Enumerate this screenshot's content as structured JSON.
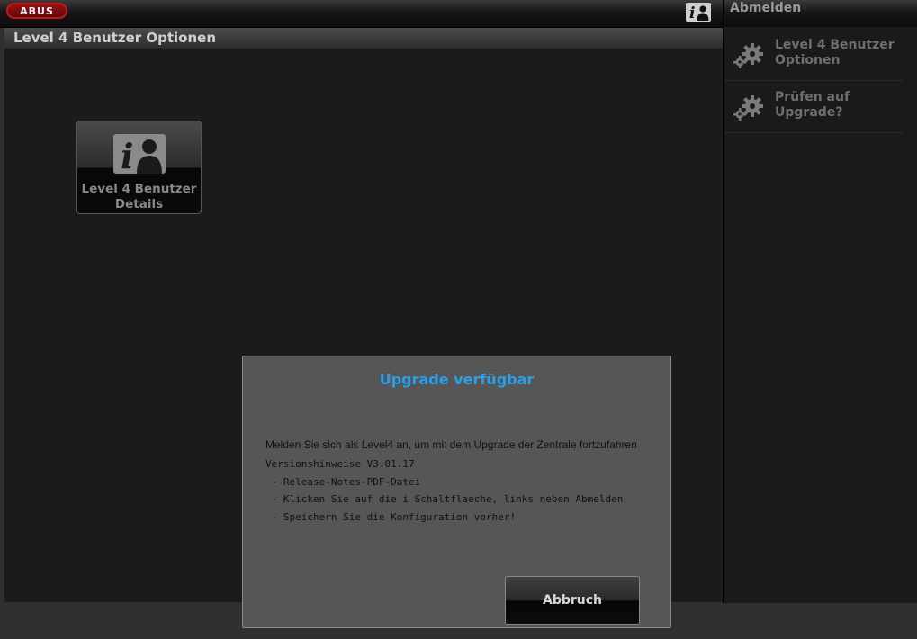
{
  "header": {
    "logo_text": "ABUS",
    "info_icon": "user-info-icon"
  },
  "page": {
    "title": "Level 4 Benutzer Optionen"
  },
  "tiles": [
    {
      "label": "Level 4 Benutzer Details",
      "icon": "user-info-icon"
    }
  ],
  "sidebar": {
    "logout_label": "Abmelden",
    "items": [
      {
        "label": "Level 4 Benutzer Optionen",
        "icon": "gears-icon"
      },
      {
        "label": "Prüfen auf Upgrade?",
        "icon": "gears-icon"
      }
    ]
  },
  "dialog": {
    "title": "Upgrade verfügbar",
    "message": "Melden Sie sich als Level4 an, um mit dem Upgrade der Zentrale fortzufahren",
    "notes": [
      "Versionshinweise V3.01.17",
      " - Release-Notes-PDF-Datei",
      " - Klicken Sie auf die i Schaltflaeche, links neben Abmelden",
      " - Speichern Sie die Konfiguration vorher!"
    ],
    "cancel_label": "Abbruch"
  },
  "colors": {
    "dialog_title": "#2aa0e8",
    "brand_red": "#c4161c"
  }
}
